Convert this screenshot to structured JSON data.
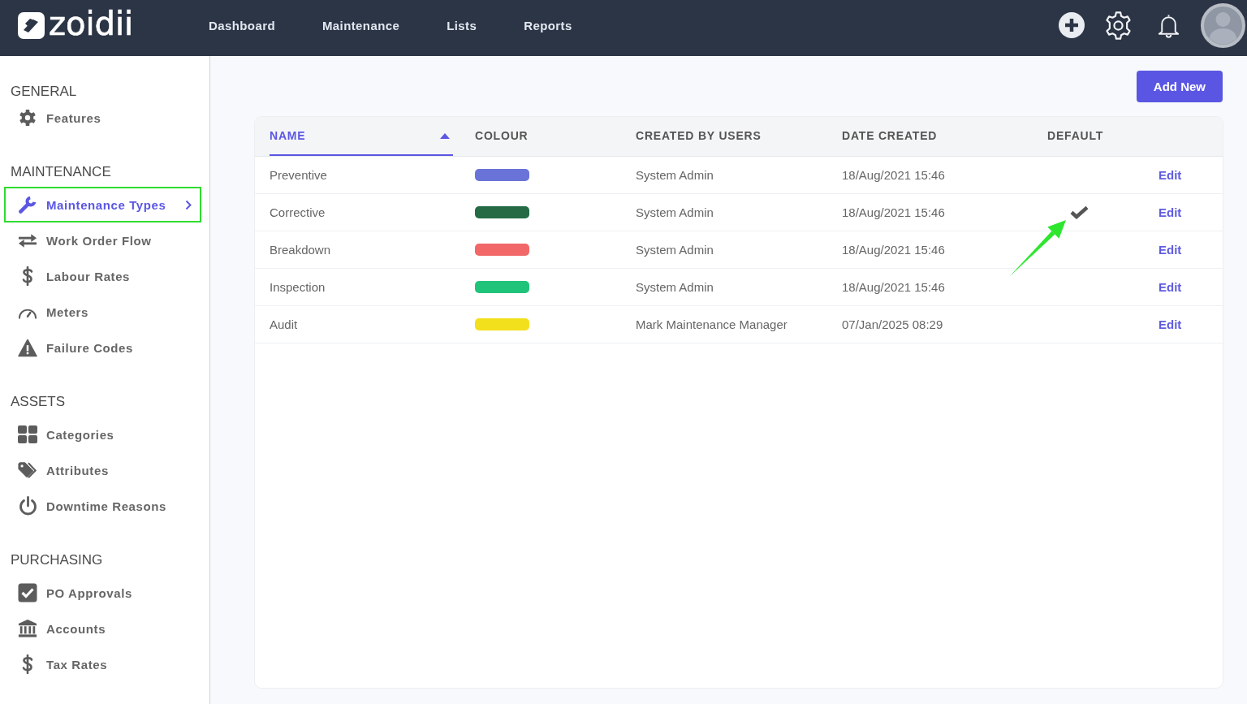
{
  "header": {
    "logo_text": "zoidii",
    "nav": [
      "Dashboard",
      "Maintenance",
      "Lists",
      "Reports"
    ]
  },
  "sidebar": {
    "sections": [
      {
        "title": "GENERAL",
        "items": [
          {
            "label": "Features",
            "selected": false
          }
        ]
      },
      {
        "title": "MAINTENANCE",
        "items": [
          {
            "label": "Maintenance Types",
            "selected": true
          },
          {
            "label": "Work Order Flow",
            "selected": false
          },
          {
            "label": "Labour Rates",
            "selected": false
          },
          {
            "label": "Meters",
            "selected": false
          },
          {
            "label": "Failure Codes",
            "selected": false
          }
        ]
      },
      {
        "title": "ASSETS",
        "items": [
          {
            "label": "Categories",
            "selected": false
          },
          {
            "label": "Attributes",
            "selected": false
          },
          {
            "label": "Downtime Reasons",
            "selected": false
          }
        ]
      },
      {
        "title": "PURCHASING",
        "items": [
          {
            "label": "PO Approvals",
            "selected": false
          },
          {
            "label": "Accounts",
            "selected": false
          },
          {
            "label": "Tax Rates",
            "selected": false
          }
        ]
      }
    ]
  },
  "add_button": "Add New",
  "table": {
    "columns": [
      {
        "label": "NAME",
        "sorted": true
      },
      {
        "label": "COLOUR",
        "sorted": false
      },
      {
        "label": "CREATED BY USERS",
        "sorted": false
      },
      {
        "label": "DATE CREATED",
        "sorted": false
      },
      {
        "label": "DEFAULT",
        "sorted": false
      }
    ],
    "rows": [
      {
        "name": "Preventive",
        "color": "#6a74d8",
        "created_by": "System Admin",
        "date_created": "18/Aug/2021 15:46",
        "default": false,
        "action": "Edit"
      },
      {
        "name": "Corrective",
        "color": "#256a45",
        "created_by": "System Admin",
        "date_created": "18/Aug/2021 15:46",
        "default": true,
        "action": "Edit"
      },
      {
        "name": "Breakdown",
        "color": "#f26767",
        "created_by": "System Admin",
        "date_created": "18/Aug/2021 15:46",
        "default": false,
        "action": "Edit"
      },
      {
        "name": "Inspection",
        "color": "#1fc47a",
        "created_by": "System Admin",
        "date_created": "18/Aug/2021 15:46",
        "default": false,
        "action": "Edit"
      },
      {
        "name": "Audit",
        "color": "#f2e01c",
        "created_by": "Mark Maintenance Manager",
        "date_created": "07/Jan/2025 08:29",
        "default": false,
        "action": "Edit"
      }
    ]
  },
  "annotation": {
    "highlight_selected_item": true,
    "arrow_to_default": true
  }
}
